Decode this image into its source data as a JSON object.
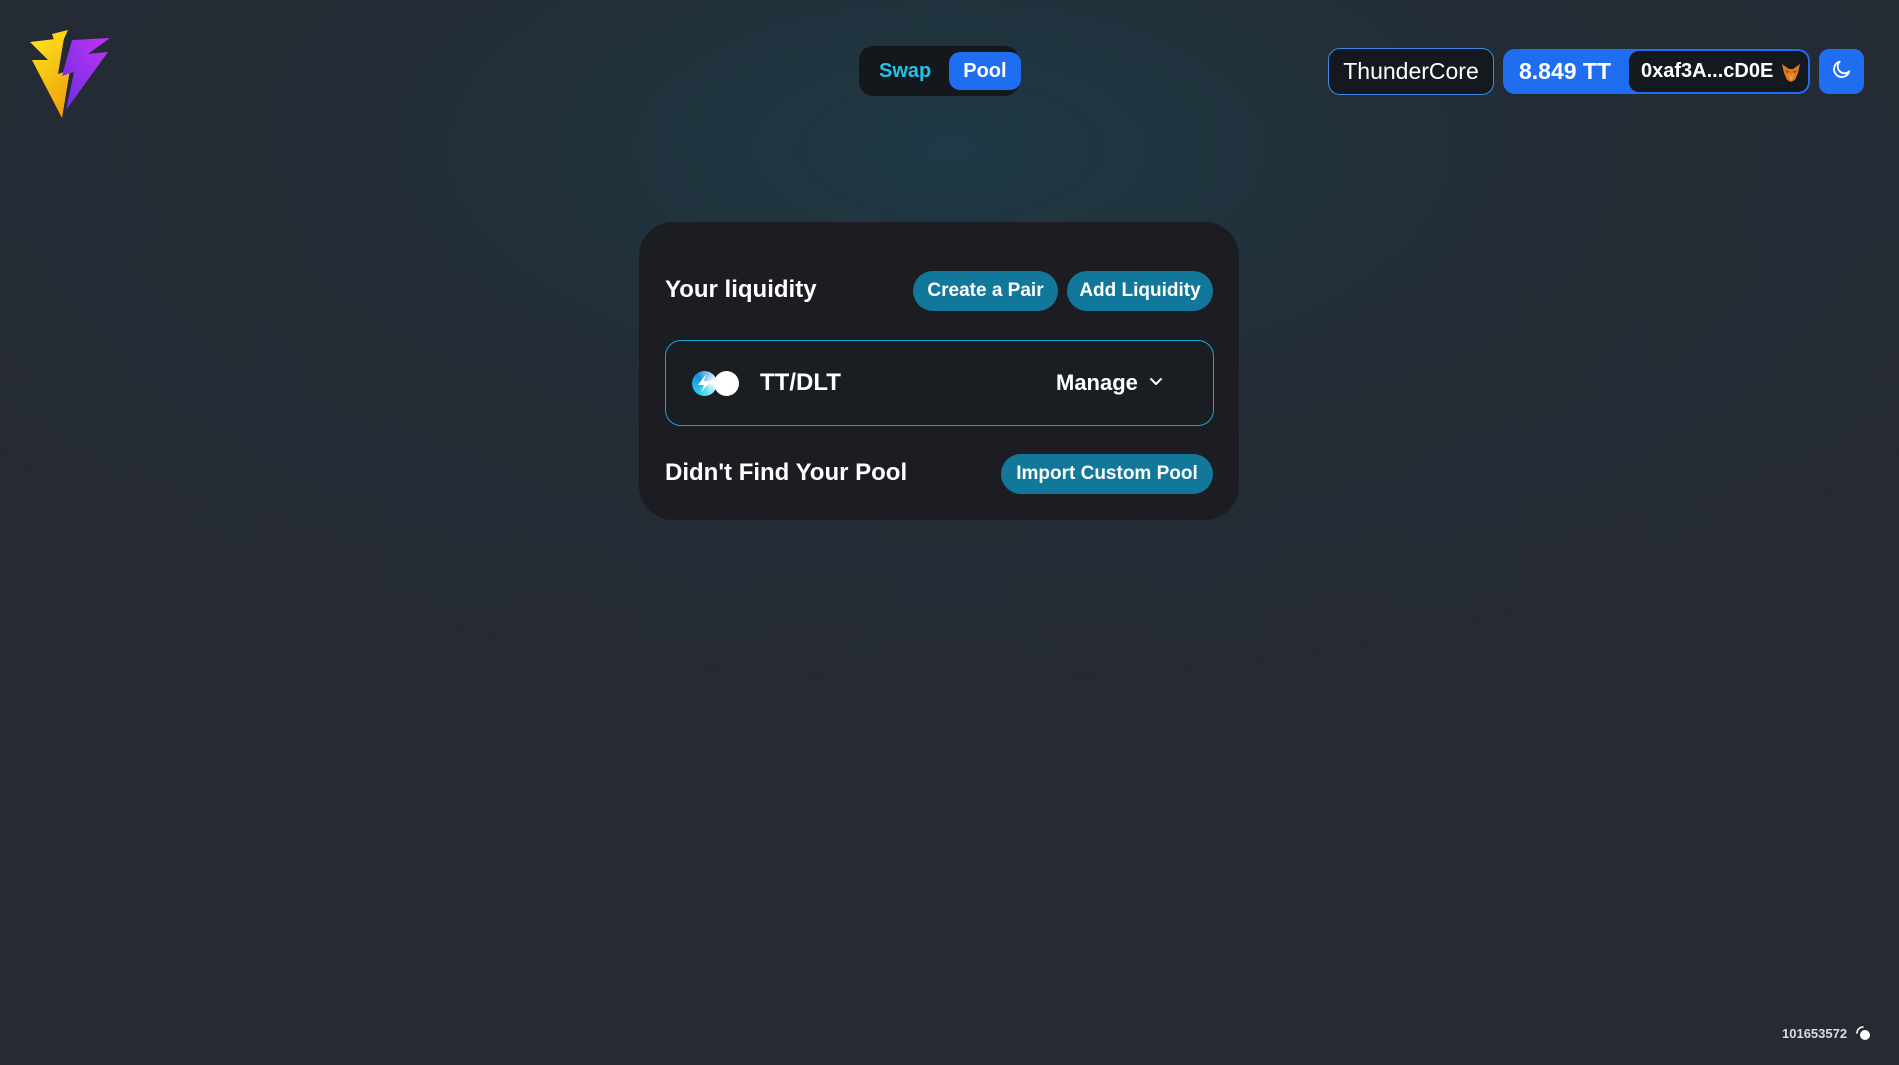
{
  "header": {
    "logo_icon": "thunder-logo-icon",
    "nav": {
      "swap_label": "Swap",
      "pool_label": "Pool",
      "active": "Pool"
    },
    "network_label": "ThunderCore",
    "balance": "8.849 TT",
    "address": "0xaf3A...cD0E",
    "wallet_icon": "metamask-fox-icon",
    "theme_icon": "moon-icon"
  },
  "card": {
    "title": "Your liquidity",
    "create_pair_label": "Create a Pair",
    "add_liquidity_label": "Add Liquidity",
    "pools": [
      {
        "pair": "TT/DLT",
        "manage_label": "Manage",
        "token_icons": [
          "tt-token-icon",
          "dlt-token-icon"
        ]
      }
    ],
    "not_found_text": "Didn't Find Your Pool",
    "import_label": "Import Custom Pool"
  },
  "footer": {
    "block_number": "101653572",
    "status_icon": "block-sync-icon"
  },
  "colors": {
    "accent_blue": "#1f6df0",
    "teal_button": "#12789b",
    "swap_cyan": "#22c3e6",
    "card_bg": "#1b1d22"
  }
}
